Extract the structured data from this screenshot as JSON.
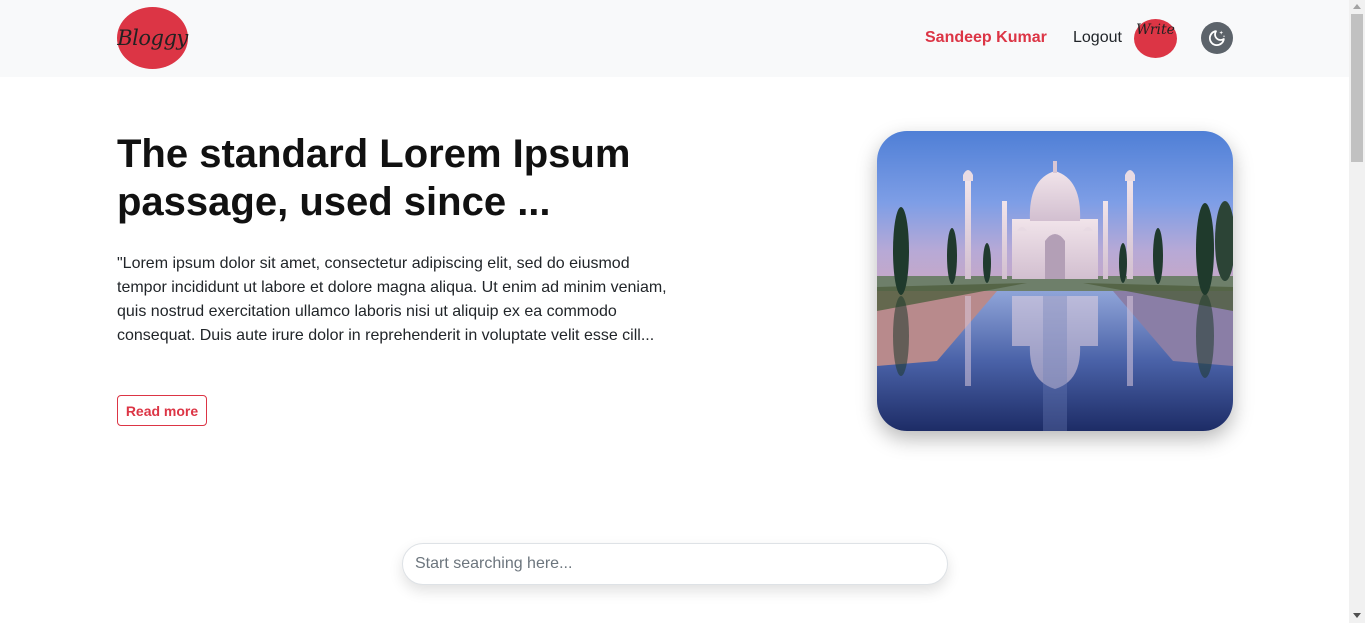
{
  "navbar": {
    "logo_text": "Bloggy",
    "user_name": "Sandeep Kumar",
    "logout_label": "Logout",
    "write_label": "Write",
    "theme_icon": "moon-stars-icon"
  },
  "hero": {
    "title": "The standard Lorem Ipsum passage, used since ...",
    "body": "\"Lorem ipsum dolor sit amet, consectetur adipiscing elit, sed do eiusmod tempor incididunt ut labore et dolore magna aliqua. Ut enim ad minim veniam, quis nostrud exercitation ullamco laboris nisi ut aliquip ex ea commodo consequat. Duis aute irure dolor in reprehenderit in voluptate velit esse cill...",
    "read_more_label": "Read more",
    "image_subject": "taj-mahal-photo"
  },
  "search": {
    "placeholder": "Start searching here...",
    "value": ""
  },
  "colors": {
    "accent": "#dc3545",
    "navbar_bg": "#f8f9fa",
    "theme_button_bg": "#5c636a"
  }
}
